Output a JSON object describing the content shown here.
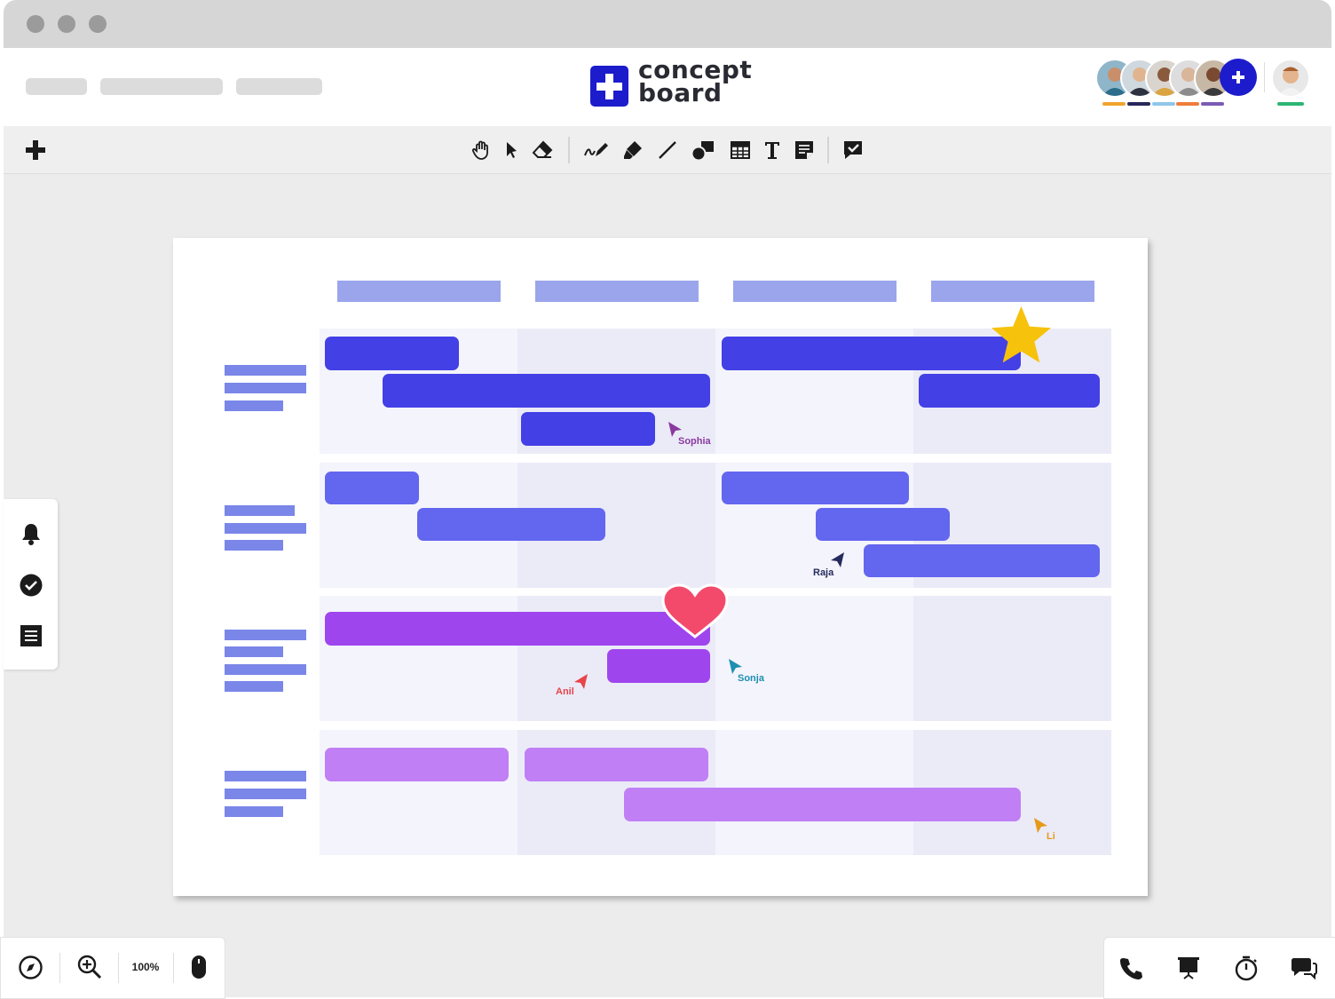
{
  "app": {
    "logo_line1": "concept",
    "logo_line2": "board"
  },
  "toolbar": {
    "add_icon": "plus-icon",
    "tools": [
      "hand-icon",
      "pointer-icon",
      "eraser-icon",
      "pen-icon",
      "highlighter-icon",
      "line-icon",
      "shapes-icon",
      "table-icon",
      "text-icon",
      "sticky-note-icon",
      "review-icon"
    ]
  },
  "collaborators": {
    "add_icon": "plus-icon",
    "underline_colors": [
      "#f0a42c",
      "#27275a",
      "#8fc6ea",
      "#ef7d3a",
      "#7a5bb5"
    ],
    "self_underline": "#2bb673"
  },
  "board": {
    "reactions": [
      "star",
      "heart"
    ],
    "cursors": [
      {
        "name": "Sophia",
        "color": "#8a3a9e"
      },
      {
        "name": "Raja",
        "color": "#262b5e"
      },
      {
        "name": "Anil",
        "color": "#e8444a"
      },
      {
        "name": "Sonja",
        "color": "#1d8fb0"
      },
      {
        "name": "Li",
        "color": "#e69a18"
      }
    ]
  },
  "side_panel": {
    "items": [
      "bell-icon",
      "check-circle-icon",
      "list-icon"
    ]
  },
  "bottom_left": {
    "zoom": "100%",
    "items": [
      "compass-icon",
      "zoom-in-icon",
      "mouse-icon"
    ]
  },
  "bottom_right": {
    "items": [
      "phone-icon",
      "presentation-icon",
      "timer-icon",
      "chat-icon"
    ]
  }
}
